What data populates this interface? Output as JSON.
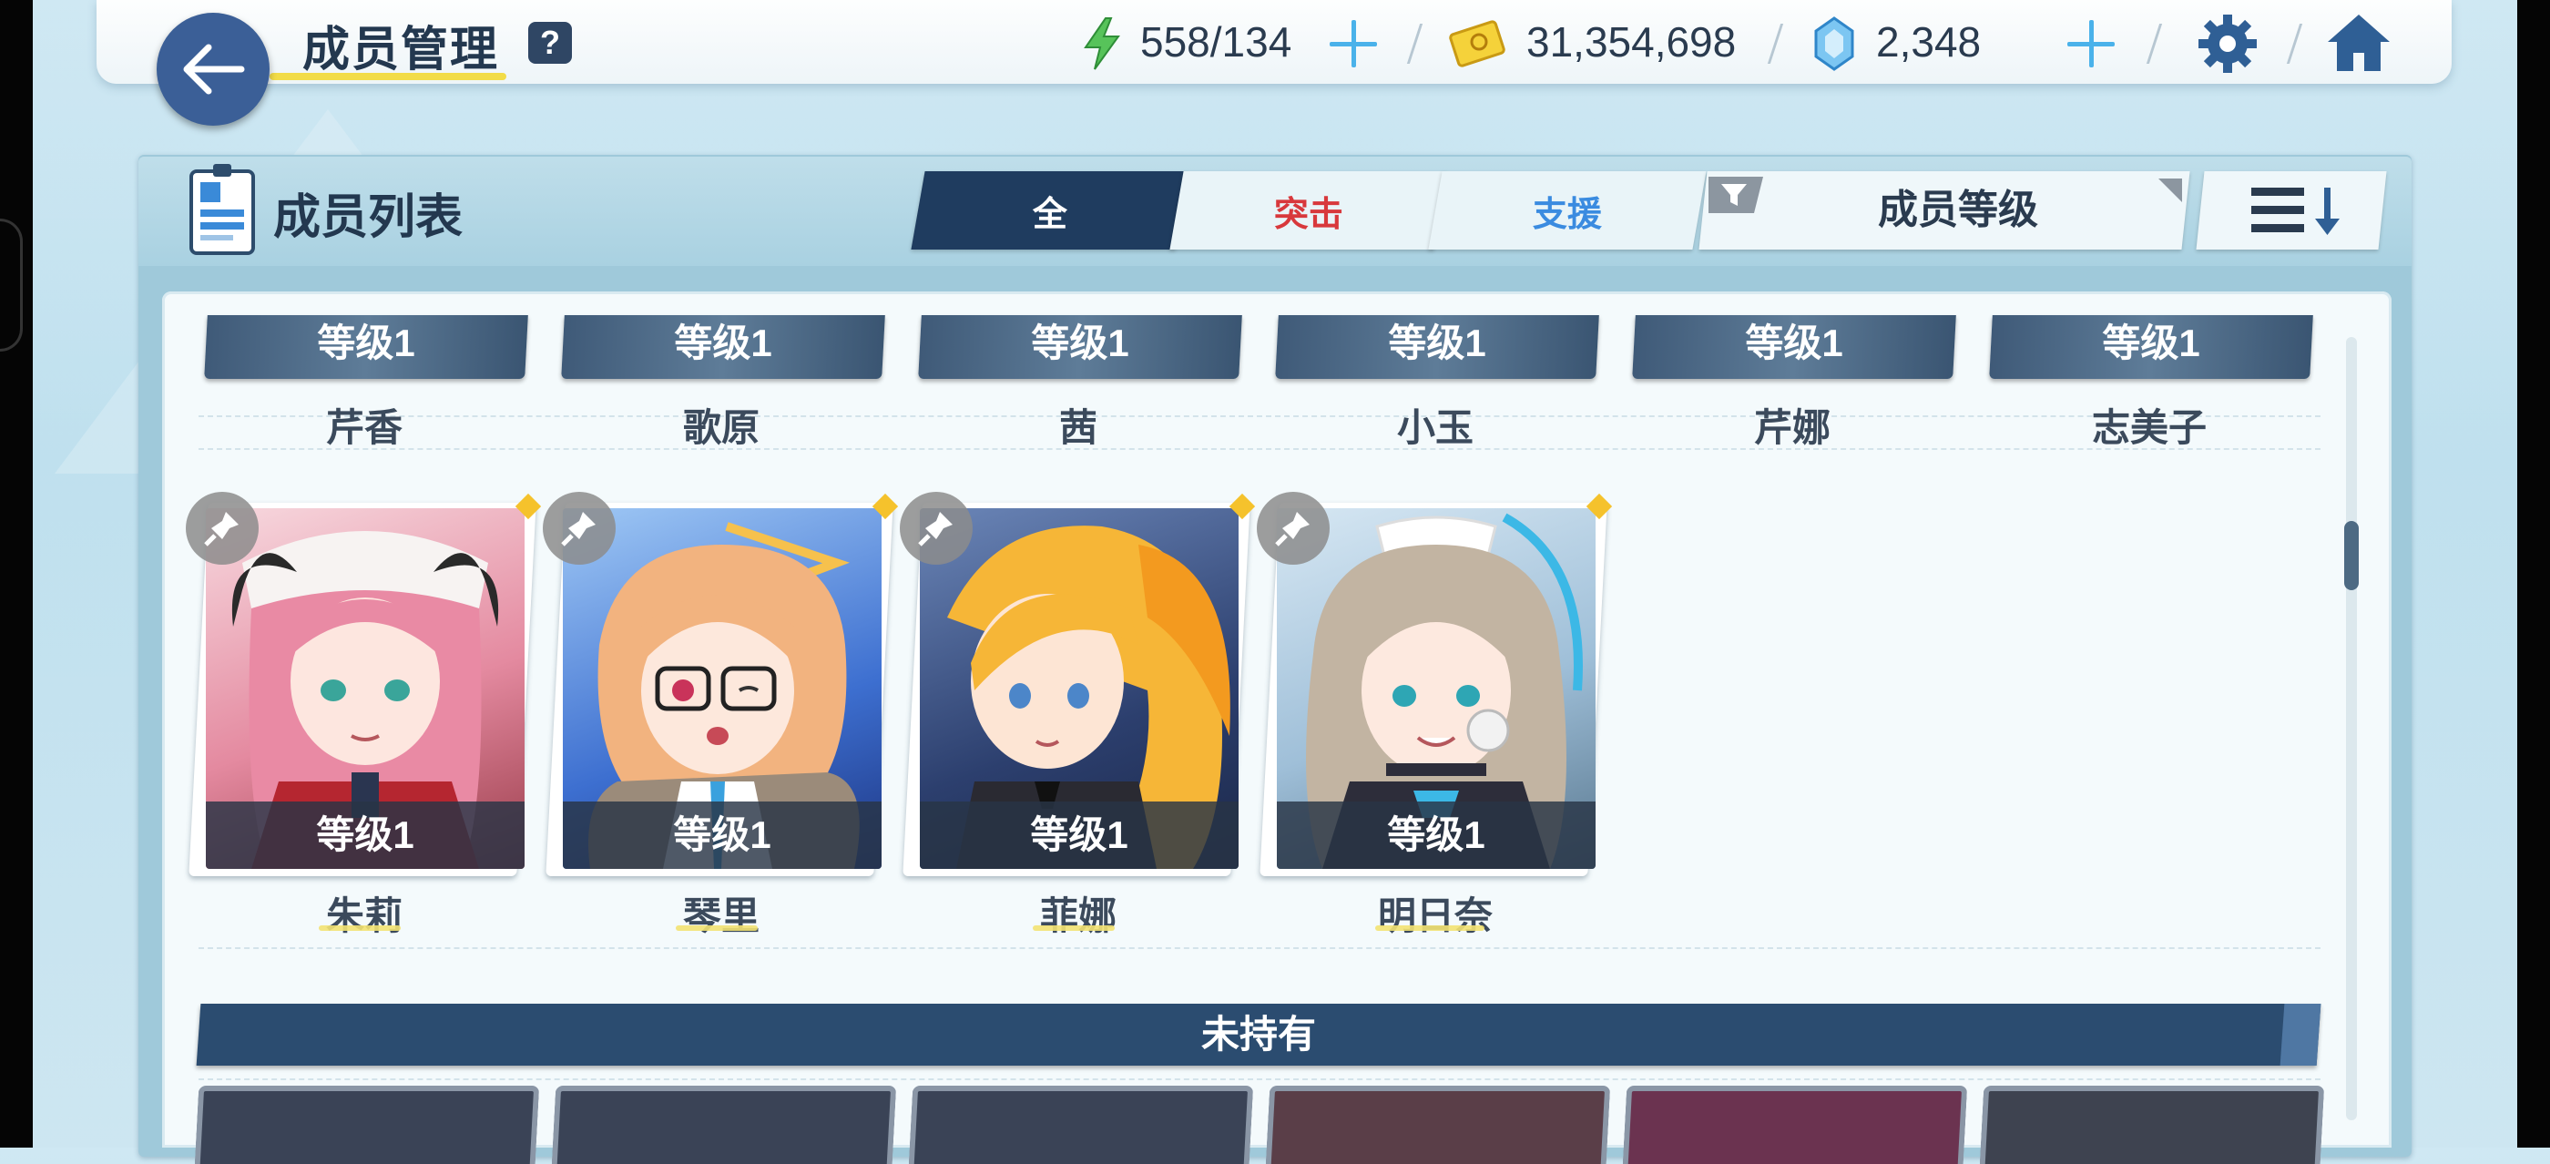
{
  "header": {
    "title": "成员管理",
    "help": "?",
    "energy": "558/134",
    "credits": "31,354,698",
    "gems": "2,348"
  },
  "panel": {
    "title": "成员列表",
    "tabs": [
      {
        "label": "全",
        "color": "#ffffff"
      },
      {
        "label": "突击",
        "color": "#d8383c"
      },
      {
        "label": "支援",
        "color": "#3a8be0"
      }
    ],
    "sort_by": "成员等级"
  },
  "level_label": "等级1",
  "top_row": [
    {
      "name": "芹香"
    },
    {
      "name": "歌原"
    },
    {
      "name": "茜"
    },
    {
      "name": "小玉"
    },
    {
      "name": "芹娜"
    },
    {
      "name": "志美子"
    }
  ],
  "members": [
    {
      "name": "朱莉",
      "level": "等级1",
      "hair": "#e98aa4"
    },
    {
      "name": "琴里",
      "level": "等级1",
      "hair": "#f2b37f"
    },
    {
      "name": "菲娜",
      "level": "等级1",
      "hair": "#f6b637"
    },
    {
      "name": "明日奈",
      "level": "等级1",
      "hair": "#c2b4a2"
    }
  ],
  "unowned_label": "未持有"
}
